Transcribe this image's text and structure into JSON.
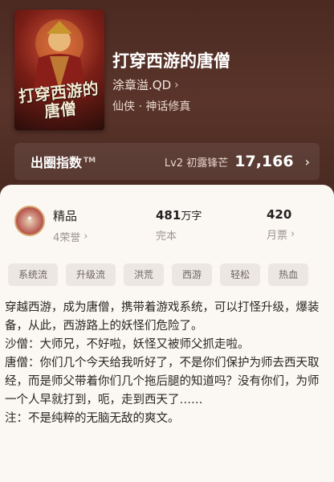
{
  "book": {
    "cover_title": "打穿西游的唐僧",
    "title": "打穿西游的唐僧",
    "author": "涂章溢.QD",
    "genre": "仙侠 · 神话修真"
  },
  "circle": {
    "title": "出圈指数",
    "tm": "TM",
    "level": "Lv2 初露锋芒",
    "score": "17,166"
  },
  "stats": {
    "quality": {
      "main": "精品",
      "sub": "4荣誉"
    },
    "words": {
      "number": "481",
      "unit": "万字",
      "sub": "完本"
    },
    "tickets": {
      "number": "420",
      "sub": "月票"
    }
  },
  "tags": [
    "系统流",
    "升级流",
    "洪荒",
    "西游",
    "轻松",
    "热血"
  ],
  "description": [
    "穿越西游，成为唐僧，携带着游戏系统，可以打怪升级，爆装备，从此，西游路上的妖怪们危险了。",
    "沙僧：大师兄，不好啦，妖怪又被师父抓走啦。",
    "唐僧：你们几个今天给我听好了，不是你们保护为师去西天取经，而是师父带着你们几个拖后腿的知道吗？没有你们，为师一个人早就打到，呃，走到西天了……",
    "注：不是纯粹的无脑无敌的爽文。"
  ],
  "colors": {
    "hero_bg": "#4b2a22",
    "card_bg": "#fbf7f3",
    "tag_bg": "#ece7e2"
  }
}
